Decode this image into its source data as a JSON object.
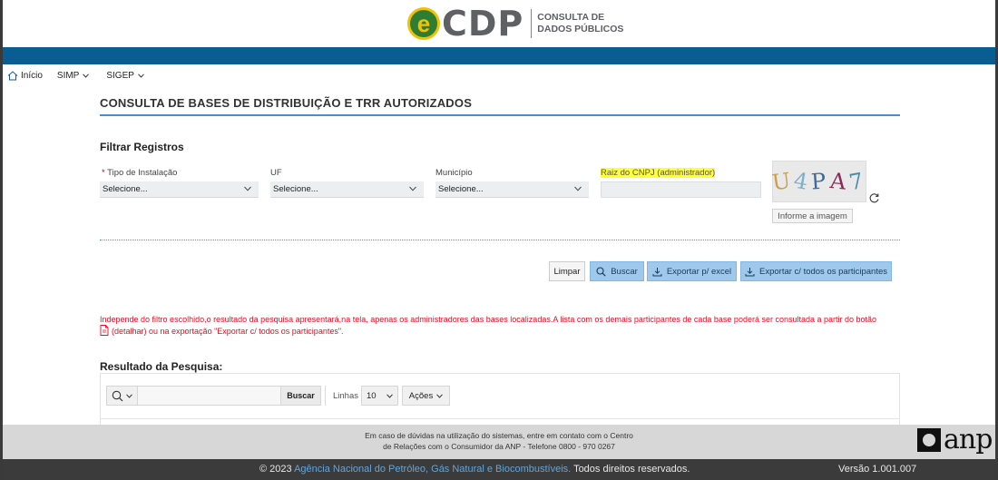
{
  "header": {
    "logo_letter": "e",
    "logo_name": "CDP",
    "logo_sub_line1": "CONSULTA DE",
    "logo_sub_line2": "DADOS PÚBLICOS"
  },
  "nav": {
    "items": [
      {
        "label": "Início"
      },
      {
        "label": "SIMP"
      },
      {
        "label": "SIGEP"
      }
    ]
  },
  "page": {
    "title": "CONSULTA DE BASES DE DISTRIBUIÇÃO E TRR AUTORIZADOS"
  },
  "filters": {
    "section_title": "Filtrar Registros",
    "required_mark": "*",
    "tipo_label": "Tipo de Instalação",
    "tipo_value": "Selecione...",
    "uf_label": "UF",
    "uf_value": "Selecione...",
    "municipio_label": "Município",
    "municipio_value": "Selecione...",
    "cnpj_label": "Raiz do CNPJ (administrador)",
    "cnpj_value": ""
  },
  "captcha": {
    "chars": [
      "U",
      "4",
      "P",
      "A",
      "7"
    ],
    "colors": [
      "#c8a050",
      "#7fb0c8",
      "#3d6a9a",
      "#8a2a5a",
      "#4a8aa8"
    ],
    "input_placeholder": "Informe a imagem"
  },
  "actions": {
    "limpar": "Limpar",
    "buscar": "Buscar",
    "export_excel": "Exportar p/ excel",
    "export_all": "Exportar c/ todos os participantes"
  },
  "warning": {
    "line1": "Independe do filtro escolhido,o resultado da pesquisa apresentará,na tela, apenas os administradores das bases localizadas.A lista com os demais participantes de cada base poderá ser consultada a partir do botão",
    "line2": "(detalhar) ou na exportação \"Exportar c/ todos os participantes\"."
  },
  "results": {
    "title": "Resultado da Pesquisa:",
    "search_placeholder": "",
    "buscar": "Buscar",
    "linhas_label": "Linhas",
    "linhas_value": "10",
    "acoes_label": "Ações"
  },
  "footer": {
    "contact_line1": "Em caso de dúvidas na utilização do sistemas, entre em contato com o Centro",
    "contact_line2": "de Relações com o Consumidor da ANP - Telefone 0800 - 970 0267",
    "anp_logo_text": "anp",
    "copyright_prefix": "© 2023",
    "agency": "Agência Nacional do Petróleo, Gás Natural e Biocombustíveis.",
    "rights": "Todos direitos reservados.",
    "version": "Versão 1.001.007"
  },
  "colors": {
    "brand_blue": "#0a5d92",
    "accent_line": "#4a90c8",
    "button_blue": "#9ec9ec",
    "warning_red": "#e01020",
    "footer_gray": "#d7d7d7",
    "bottom_bar": "#3b3b3b"
  }
}
